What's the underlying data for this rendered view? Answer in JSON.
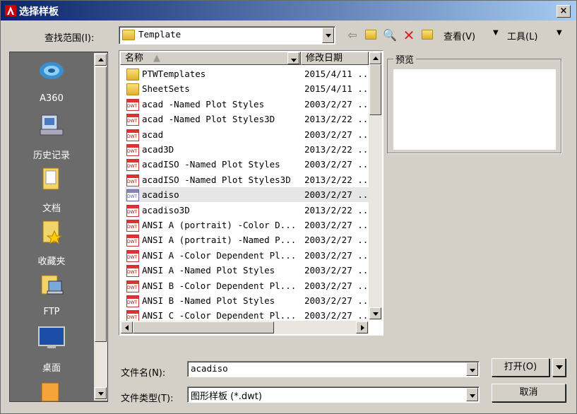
{
  "window": {
    "title": "选择样板",
    "close": "×"
  },
  "toolbar": {
    "look_in_label": "查找范围(I):",
    "look_in_value": "Template",
    "views_label": "查看(V)",
    "tools_label": "工具(L)"
  },
  "places": [
    {
      "label": "A360",
      "icon": "a360-icon"
    },
    {
      "label": "历史记录",
      "icon": "history-icon"
    },
    {
      "label": "文档",
      "icon": "documents-icon"
    },
    {
      "label": "收藏夹",
      "icon": "favorites-icon"
    },
    {
      "label": "FTP",
      "icon": "ftp-icon"
    },
    {
      "label": "桌面",
      "icon": "desktop-icon"
    }
  ],
  "columns": {
    "name": "名称",
    "date": "修改日期"
  },
  "files": [
    {
      "name": "PTWTemplates",
      "date": "2015/4/11 ..",
      "type": "folder"
    },
    {
      "name": "SheetSets",
      "date": "2015/4/11 ..",
      "type": "folder"
    },
    {
      "name": "acad -Named Plot Styles",
      "date": "2003/2/27 ..",
      "type": "dwt"
    },
    {
      "name": "acad -Named Plot Styles3D",
      "date": "2013/2/22 ..",
      "type": "dwt"
    },
    {
      "name": "acad",
      "date": "2003/2/27 ..",
      "type": "dwt"
    },
    {
      "name": "acad3D",
      "date": "2013/2/22 ..",
      "type": "dwt"
    },
    {
      "name": "acadISO -Named Plot Styles",
      "date": "2003/2/27 ..",
      "type": "dwt"
    },
    {
      "name": "acadISO -Named Plot Styles3D",
      "date": "2013/2/22 ..",
      "type": "dwt"
    },
    {
      "name": "acadiso",
      "date": "2003/2/27 ..",
      "type": "dwt-selected"
    },
    {
      "name": "acadiso3D",
      "date": "2013/2/22 ..",
      "type": "dwt"
    },
    {
      "name": "ANSI A (portrait) -Color D...",
      "date": "2003/2/27 ..",
      "type": "dwt"
    },
    {
      "name": "ANSI A (portrait) -Named P...",
      "date": "2003/2/27 ..",
      "type": "dwt"
    },
    {
      "name": "ANSI A -Color Dependent Pl...",
      "date": "2003/2/27 ..",
      "type": "dwt"
    },
    {
      "name": "ANSI A -Named Plot Styles",
      "date": "2003/2/27 ..",
      "type": "dwt"
    },
    {
      "name": "ANSI B -Color Dependent Pl...",
      "date": "2003/2/27 ..",
      "type": "dwt"
    },
    {
      "name": "ANSI B -Named Plot Styles",
      "date": "2003/2/27 ..",
      "type": "dwt"
    },
    {
      "name": "ANSI C -Color Dependent Pl...",
      "date": "2003/2/27 ..",
      "type": "dwt"
    }
  ],
  "preview_label": "预览",
  "filename": {
    "label": "文件名(N):",
    "value": "acadiso"
  },
  "filetype": {
    "label": "文件类型(T):",
    "value": "图形样板 (*.dwt)"
  },
  "buttons": {
    "open": "打开(O)",
    "cancel": "取消"
  },
  "colors": {
    "title_start": "#0a246a",
    "title_end": "#a6caf0",
    "dialog_bg": "#d4d0c8",
    "places_bg": "#6b6b6b"
  }
}
